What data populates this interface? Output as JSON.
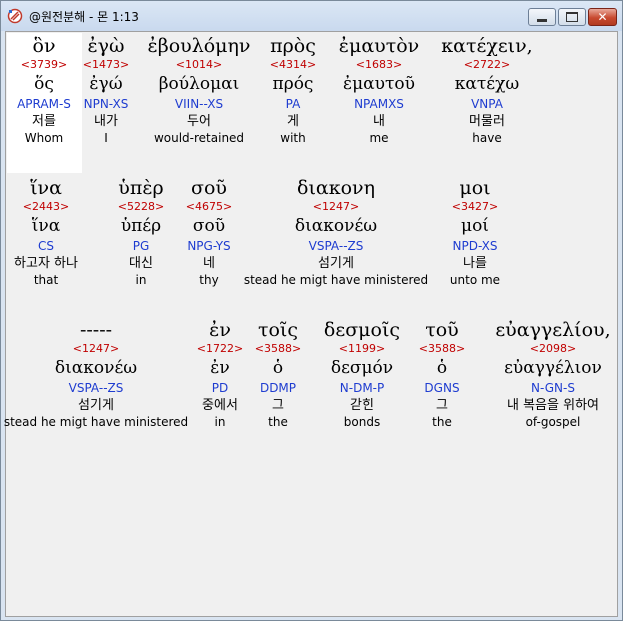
{
  "window": {
    "title": "@원전분해 - 몬 1:13",
    "buttons": {
      "minimize": "minimize-icon",
      "maximize": "maximize-icon",
      "close": "close-icon"
    }
  },
  "colors": {
    "strong": "#c00000",
    "morph": "#1e3cd0",
    "text": "#000000",
    "highlight": "#ffffff",
    "background": "#f0f0f0"
  },
  "verse": {
    "rows": [
      {
        "words": [
          {
            "greek": "ὃν",
            "strong": "<3739>",
            "lemma": "ὅς",
            "morph": "APRAM-S",
            "korean": "저를",
            "english": "Whom",
            "selected": true
          },
          {
            "greek": "ἐγὼ",
            "strong": "<1473>",
            "lemma": "ἐγώ",
            "morph": "NPN-XS",
            "korean": "내가",
            "english": "I"
          },
          {
            "greek": "ἐβουλόμην",
            "strong": "<1014>",
            "lemma": "βούλομαι",
            "morph": "VIIN--XS",
            "korean": "두어",
            "english": "would-retained"
          },
          {
            "greek": "πρὸς",
            "strong": "<4314>",
            "lemma": "πρός",
            "morph": "PA",
            "korean": "게",
            "english": "with"
          },
          {
            "greek": "ἐμαυτὸν",
            "strong": "<1683>",
            "lemma": "ἐμαυτοῦ",
            "morph": "NPAMXS",
            "korean": "내",
            "english": "me"
          },
          {
            "greek": "κατέχειν,",
            "strong": "<2722>",
            "lemma": "κατέχω",
            "morph": "VNPA",
            "korean": "머물러",
            "english": "have"
          }
        ]
      },
      {
        "words": [
          {
            "greek": "ἵνα",
            "strong": "<2443>",
            "lemma": "ἵνα",
            "morph": "CS",
            "korean": "하고자 하나",
            "english": "that"
          },
          {
            "greek": "ὑπὲρ",
            "strong": "<5228>",
            "lemma": "ὑπέρ",
            "morph": "PG",
            "korean": "대신",
            "english": "in"
          },
          {
            "greek": "σοῦ",
            "strong": "<4675>",
            "lemma": "σοῦ",
            "morph": "NPG-YS",
            "korean": "네",
            "english": "thy"
          },
          {
            "greek": "διακονη",
            "strong": "<1247>",
            "lemma": "διακονέω",
            "morph": "VSPA--ZS",
            "korean": "섬기게",
            "english": "stead he migt have ministered"
          },
          {
            "greek": "μοι",
            "strong": "<3427>",
            "lemma": "μοί",
            "morph": "NPD-XS",
            "korean": "나를",
            "english": "unto me"
          }
        ]
      },
      {
        "words": [
          {
            "greek": "-----",
            "strong": "<1247>",
            "lemma": "διακονέω",
            "morph": "VSPA--ZS",
            "korean": "섬기게",
            "english": "stead he migt have ministered"
          },
          {
            "greek": "ἐν",
            "strong": "<1722>",
            "lemma": "ἐν",
            "morph": "PD",
            "korean": "중에서",
            "english": "in"
          },
          {
            "greek": "τοῖς",
            "strong": "<3588>",
            "lemma": "ὁ",
            "morph": "DDMP",
            "korean": "그",
            "english": "the"
          },
          {
            "greek": "δεσμοῖς",
            "strong": "<1199>",
            "lemma": "δεσμόν",
            "morph": "N-DM-P",
            "korean": "갇힌",
            "english": "bonds"
          },
          {
            "greek": "τοῦ",
            "strong": "<3588>",
            "lemma": "ὁ",
            "morph": "DGNS",
            "korean": "그",
            "english": "the"
          },
          {
            "greek": "εὐαγγελίου,",
            "strong": "<2098>",
            "lemma": "εὐαγγέλιον",
            "morph": "N-GN-S",
            "korean": "내 복음을 위하여",
            "english": "of-gospel"
          }
        ]
      }
    ]
  }
}
